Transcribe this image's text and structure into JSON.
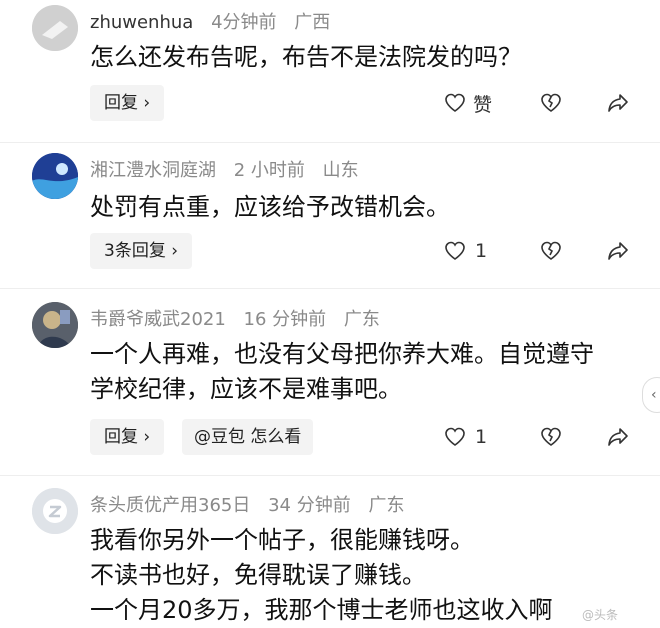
{
  "comments": [
    {
      "username": "zhuwenhua",
      "time": "4分钟前",
      "location": "广西",
      "lines": [
        "怎么还发布告呢，布告不是法院发的吗？"
      ],
      "reply_label": "回复 ›",
      "like_label": "赞"
    },
    {
      "username": "湘江澧水洞庭湖",
      "time": "2 小时前",
      "location": "山东",
      "lines": [
        "处罚有点重，应该给予改错机会。"
      ],
      "reply_label": "3条回复 ›",
      "like_label": "1"
    },
    {
      "username": "韦爵爷威武2021",
      "time": "16 分钟前",
      "location": "广东",
      "lines": [
        "一个人再难，也没有父母把你养大难。自觉遵守",
        "学校纪律，应该不是难事吧。"
      ],
      "reply_label": "回复 ›",
      "ai_label": "@豆包 怎么看",
      "like_label": "1"
    },
    {
      "username": "条头质优产用365日",
      "time": "34 分钟前",
      "location": "广东",
      "lines": [
        "我看你另外一个帖子，很能赚钱呀。",
        "不读书也好，免得耽误了赚钱。",
        "一个月20多万，我那个博士老师也这收入啊"
      ]
    }
  ],
  "scroll_tab_label": "‹",
  "watermark": "@头条"
}
